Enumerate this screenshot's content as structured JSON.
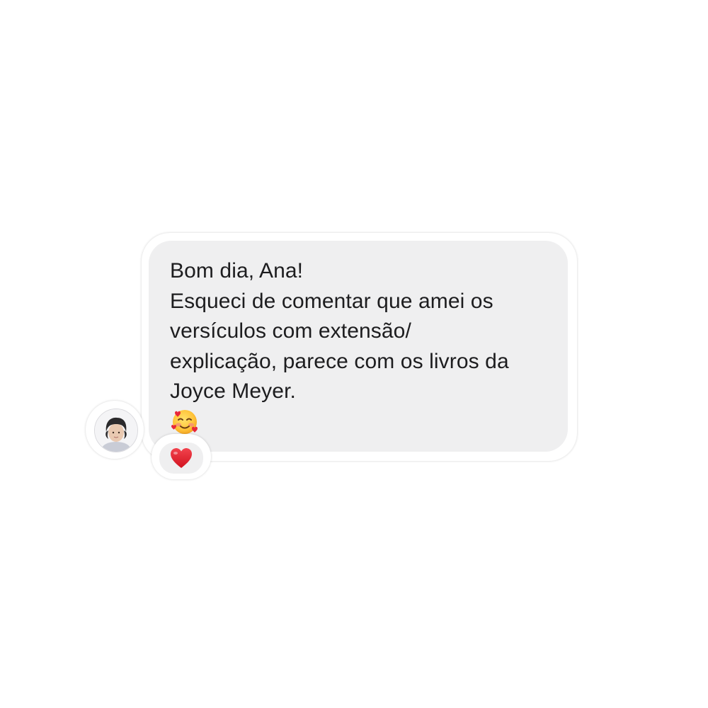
{
  "message": {
    "lines": [
      "Bom dia, Ana!",
      "Esqueci de comentar que amei os",
      "versículos com extensão/",
      "explicação, parece com os livros da",
      "Joyce Meyer."
    ],
    "emoji": "smiling-face-with-hearts"
  },
  "reaction": {
    "emoji": "red-heart"
  },
  "avatar": {
    "type": "user-photo"
  },
  "colors": {
    "bubble": "#efeff0",
    "text": "#1d1d1f",
    "heart": "#e0202c"
  }
}
